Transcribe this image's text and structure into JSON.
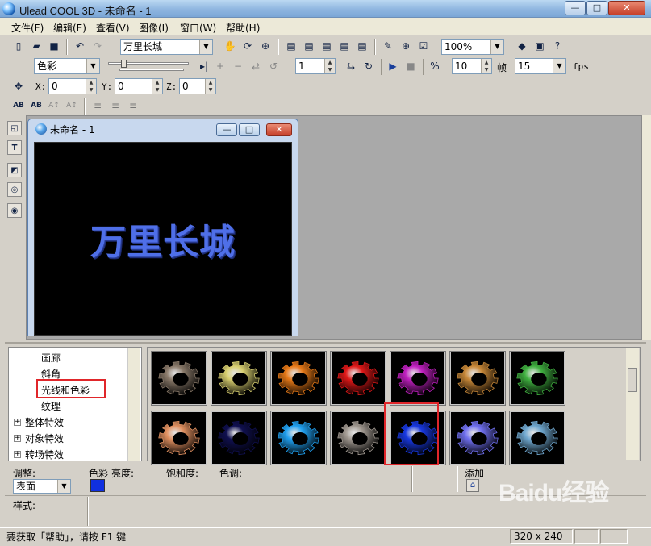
{
  "window": {
    "title": "Ulead COOL 3D - 未命名 - 1",
    "min": "—",
    "max": "□",
    "close": "✕"
  },
  "menu": [
    "文件(F)",
    "编辑(E)",
    "查看(V)",
    "图像(I)",
    "窗口(W)",
    "帮助(H)"
  ],
  "toolbar1": {
    "text_combo": "万里长城",
    "zoom": "100%"
  },
  "toolbar2": {
    "attr_combo": "色彩",
    "frame": "1",
    "fps_value": "10",
    "frame_label": "帧",
    "total_frames": "15",
    "fps_label": "fps"
  },
  "toolbar3": {
    "x_label": "X:",
    "x": "0",
    "y_label": "Y:",
    "y": "0",
    "z_label": "Z:",
    "z": "0"
  },
  "toolbar4": {
    "buttons": [
      "AB",
      "AB",
      "A↕",
      "A↕"
    ]
  },
  "document": {
    "title": "未命名 - 1",
    "canvas_text": "万里长城"
  },
  "tree": {
    "items": [
      "画廊",
      "斜角",
      "光线和色彩",
      "纹理"
    ],
    "groups": [
      "整体特效",
      "对象特效",
      "转场特效"
    ]
  },
  "gallery": {
    "row1": [
      "#8a7a6a",
      "#d8cf70",
      "#e87a18",
      "#e01818",
      "#c020c0",
      "#c88838",
      "#40b040"
    ],
    "row2": [
      "#e09060",
      "#101050",
      "#20a0f0",
      "#a09890",
      "#1838e0",
      "#7070f0",
      "#70a8d0"
    ]
  },
  "props": {
    "adjust_label": "调整:",
    "adjust_value": "表面",
    "color_label": "色彩",
    "brightness_label": "亮度:",
    "saturation_label": "饱和度:",
    "hue_label": "色调:",
    "add_label": "添加",
    "swatch": "#1030e0",
    "style_label": "样式:"
  },
  "status": {
    "help": "要获取「帮助」，请按 F1 键",
    "size": "320 x 240"
  },
  "watermark": "Baidu经验"
}
